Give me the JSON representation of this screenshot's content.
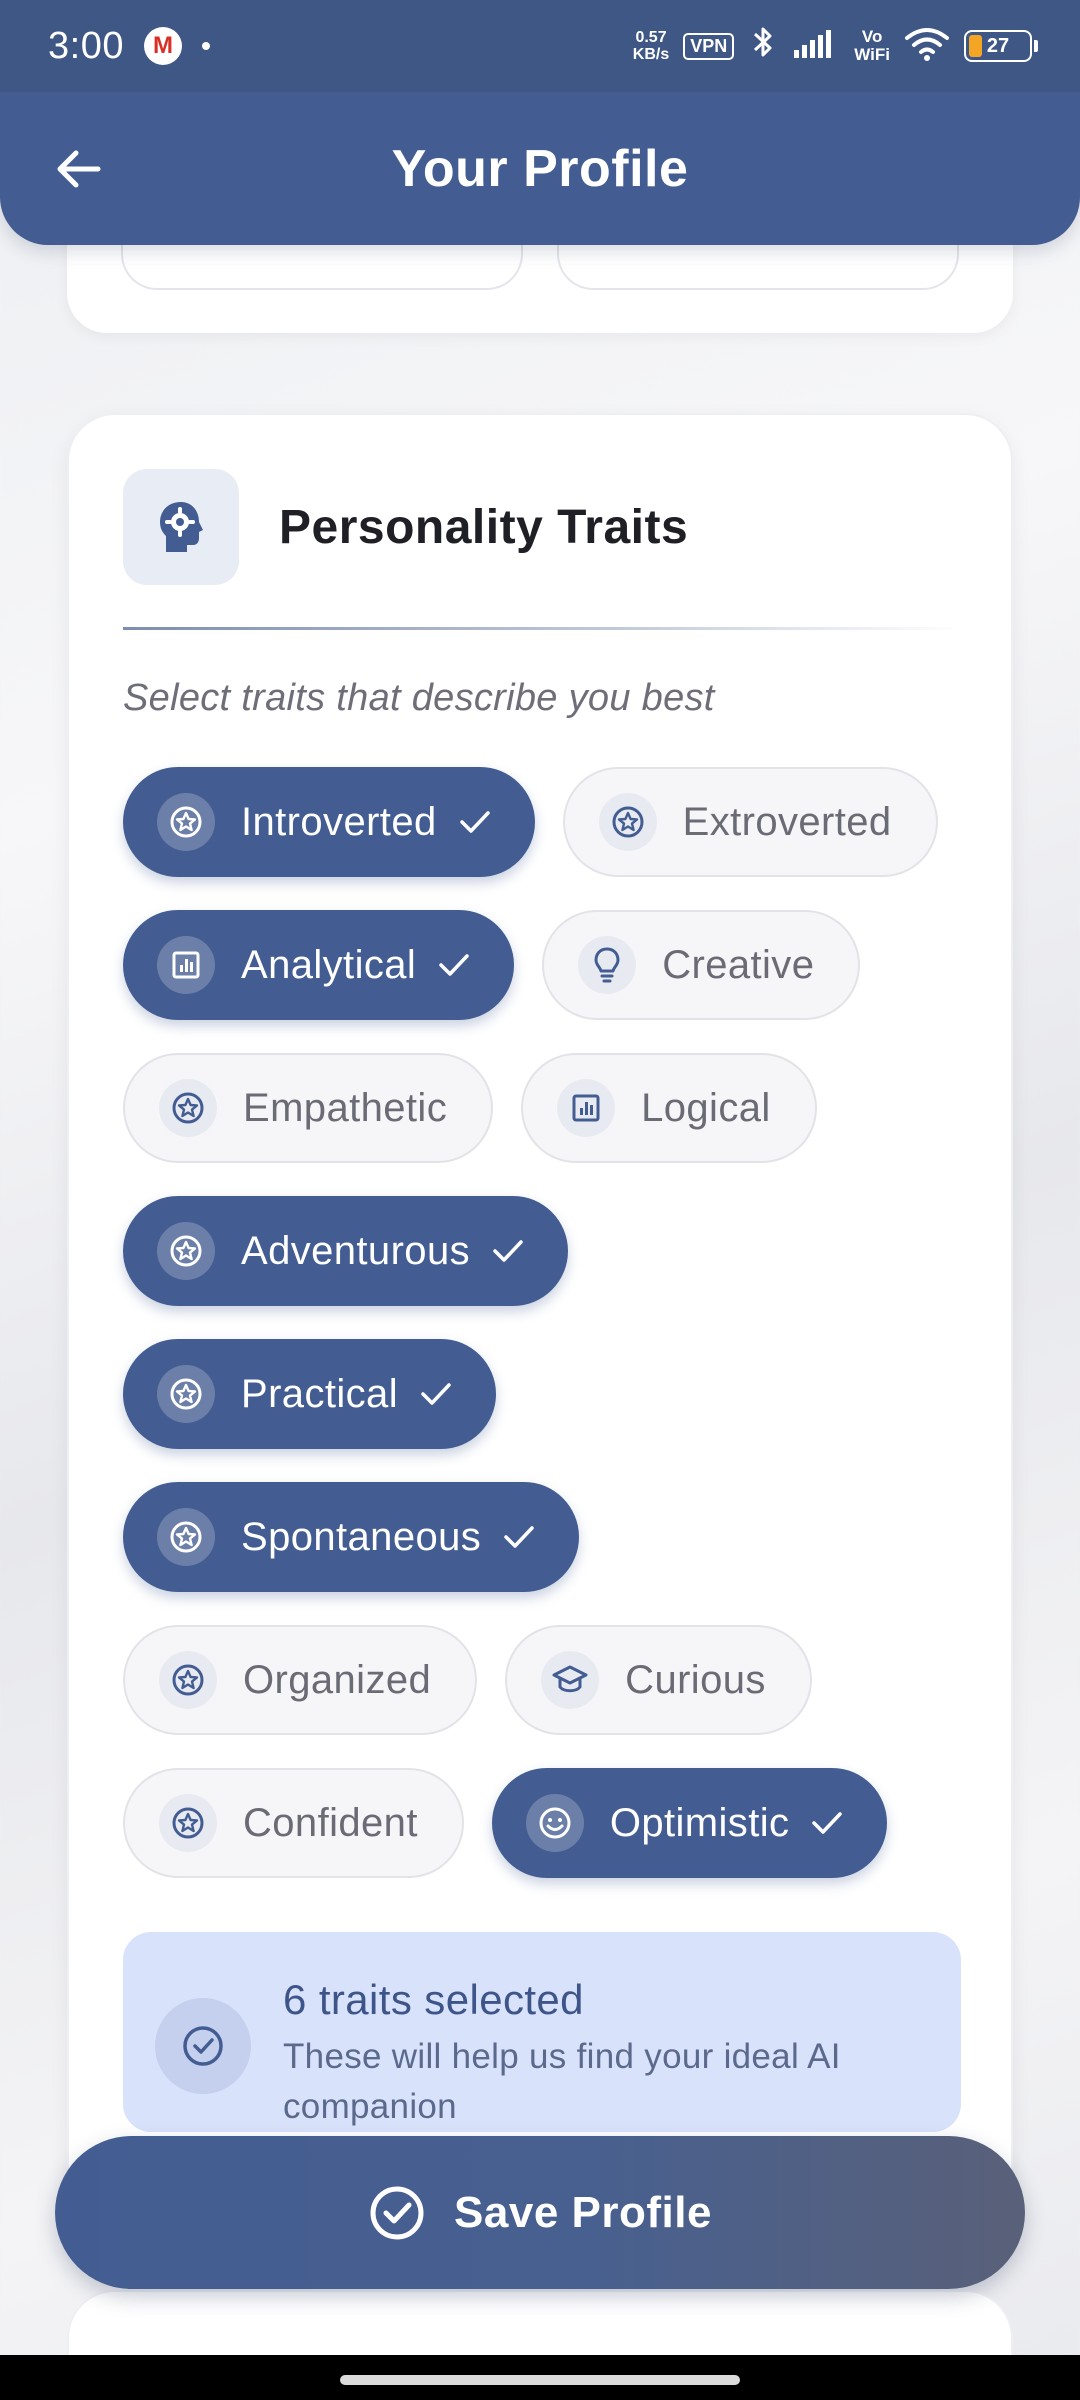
{
  "status_bar": {
    "time": "3:00",
    "speed_value": "0.57",
    "speed_unit": "KB/s",
    "vpn": "VPN",
    "vowifi_top": "Vo",
    "vowifi_bottom": "WiFi",
    "battery": "27",
    "icons": [
      "gmail-icon",
      "bluetooth-icon",
      "signal-icon",
      "wifi-icon",
      "battery-icon"
    ]
  },
  "app_bar": {
    "title": "Your Profile",
    "back_icon": "arrow-left-icon"
  },
  "traits_section": {
    "title": "Personality Traits",
    "icon": "head-gear-icon",
    "subtitle": "Select traits that describe you best",
    "rows": [
      [
        {
          "label": "Introverted",
          "selected": true,
          "icon": "star-badge-icon"
        },
        {
          "label": "Extroverted",
          "selected": false,
          "icon": "star-badge-icon"
        }
      ],
      [
        {
          "label": "Analytical",
          "selected": true,
          "icon": "bar-chart-icon"
        },
        {
          "label": "Creative",
          "selected": false,
          "icon": "lightbulb-icon"
        }
      ],
      [
        {
          "label": "Empathetic",
          "selected": false,
          "icon": "star-badge-icon"
        },
        {
          "label": "Logical",
          "selected": false,
          "icon": "bar-chart-icon"
        }
      ],
      [
        {
          "label": "Adventurous",
          "selected": true,
          "icon": "star-badge-icon"
        }
      ],
      [
        {
          "label": "Practical",
          "selected": true,
          "icon": "star-badge-icon"
        }
      ],
      [
        {
          "label": "Spontaneous",
          "selected": true,
          "icon": "star-badge-icon"
        }
      ],
      [
        {
          "label": "Organized",
          "selected": false,
          "icon": "star-badge-icon"
        },
        {
          "label": "Curious",
          "selected": false,
          "icon": "graduation-cap-icon"
        }
      ],
      [
        {
          "label": "Confident",
          "selected": false,
          "icon": "star-badge-icon"
        },
        {
          "label": "Optimistic",
          "selected": true,
          "icon": "smiley-icon"
        }
      ]
    ],
    "summary": {
      "title": "6 traits selected",
      "description": "These will help us find your ideal AI companion"
    }
  },
  "save_button": {
    "label": "Save Profile",
    "icon": "check-circle-icon"
  },
  "colors": {
    "primary": "#435d92",
    "chip_selected": "#435d92",
    "chip_unselected_bg": "#f6f6f8",
    "summary_bg": "#d9e2fb"
  }
}
